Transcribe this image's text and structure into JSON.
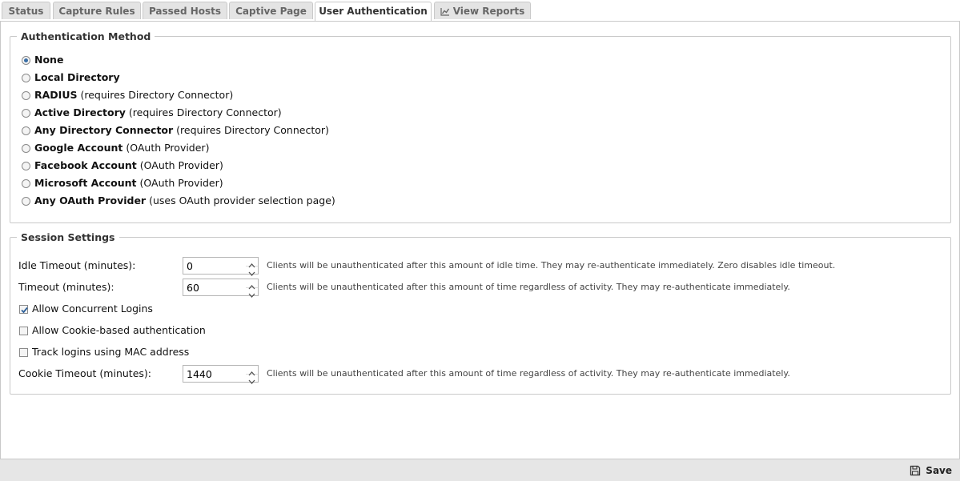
{
  "tabs": [
    {
      "label": "Status"
    },
    {
      "label": "Capture Rules"
    },
    {
      "label": "Passed Hosts"
    },
    {
      "label": "Captive Page"
    },
    {
      "label": "User Authentication",
      "active": true
    },
    {
      "label": "View Reports",
      "icon": "chart-icon"
    }
  ],
  "auth": {
    "legend": "Authentication Method",
    "options": [
      {
        "name": "None",
        "note": "",
        "checked": true
      },
      {
        "name": "Local Directory",
        "note": ""
      },
      {
        "name": "RADIUS",
        "note": "(requires Directory Connector)"
      },
      {
        "name": "Active Directory",
        "note": "(requires Directory Connector)"
      },
      {
        "name": "Any Directory Connector",
        "note": "(requires Directory Connector)"
      },
      {
        "name": "Google Account",
        "note": "(OAuth Provider)"
      },
      {
        "name": "Facebook Account",
        "note": "(OAuth Provider)"
      },
      {
        "name": "Microsoft Account",
        "note": "(OAuth Provider)"
      },
      {
        "name": "Any OAuth Provider",
        "note": "(uses OAuth provider selection page)"
      }
    ]
  },
  "session": {
    "legend": "Session Settings",
    "idle_timeout": {
      "label": "Idle Timeout (minutes):",
      "value": "0",
      "help": "Clients will be unauthenticated after this amount of idle time. They may re-authenticate immediately. Zero disables idle timeout."
    },
    "timeout": {
      "label": "Timeout (minutes):",
      "value": "60",
      "help": "Clients will be unauthenticated after this amount of time regardless of activity. They may re-authenticate immediately."
    },
    "concurrent": {
      "label": "Allow Concurrent Logins",
      "checked": true
    },
    "cookie_auth": {
      "label": "Allow Cookie-based authentication",
      "checked": false
    },
    "mac_track": {
      "label": "Track logins using MAC address",
      "checked": false
    },
    "cookie_timeout": {
      "label": "Cookie Timeout (minutes):",
      "value": "1440",
      "help": "Clients will be unauthenticated after this amount of time regardless of activity. They may re-authenticate immediately."
    }
  },
  "footer": {
    "save_label": "Save",
    "save_icon": "save-icon"
  }
}
